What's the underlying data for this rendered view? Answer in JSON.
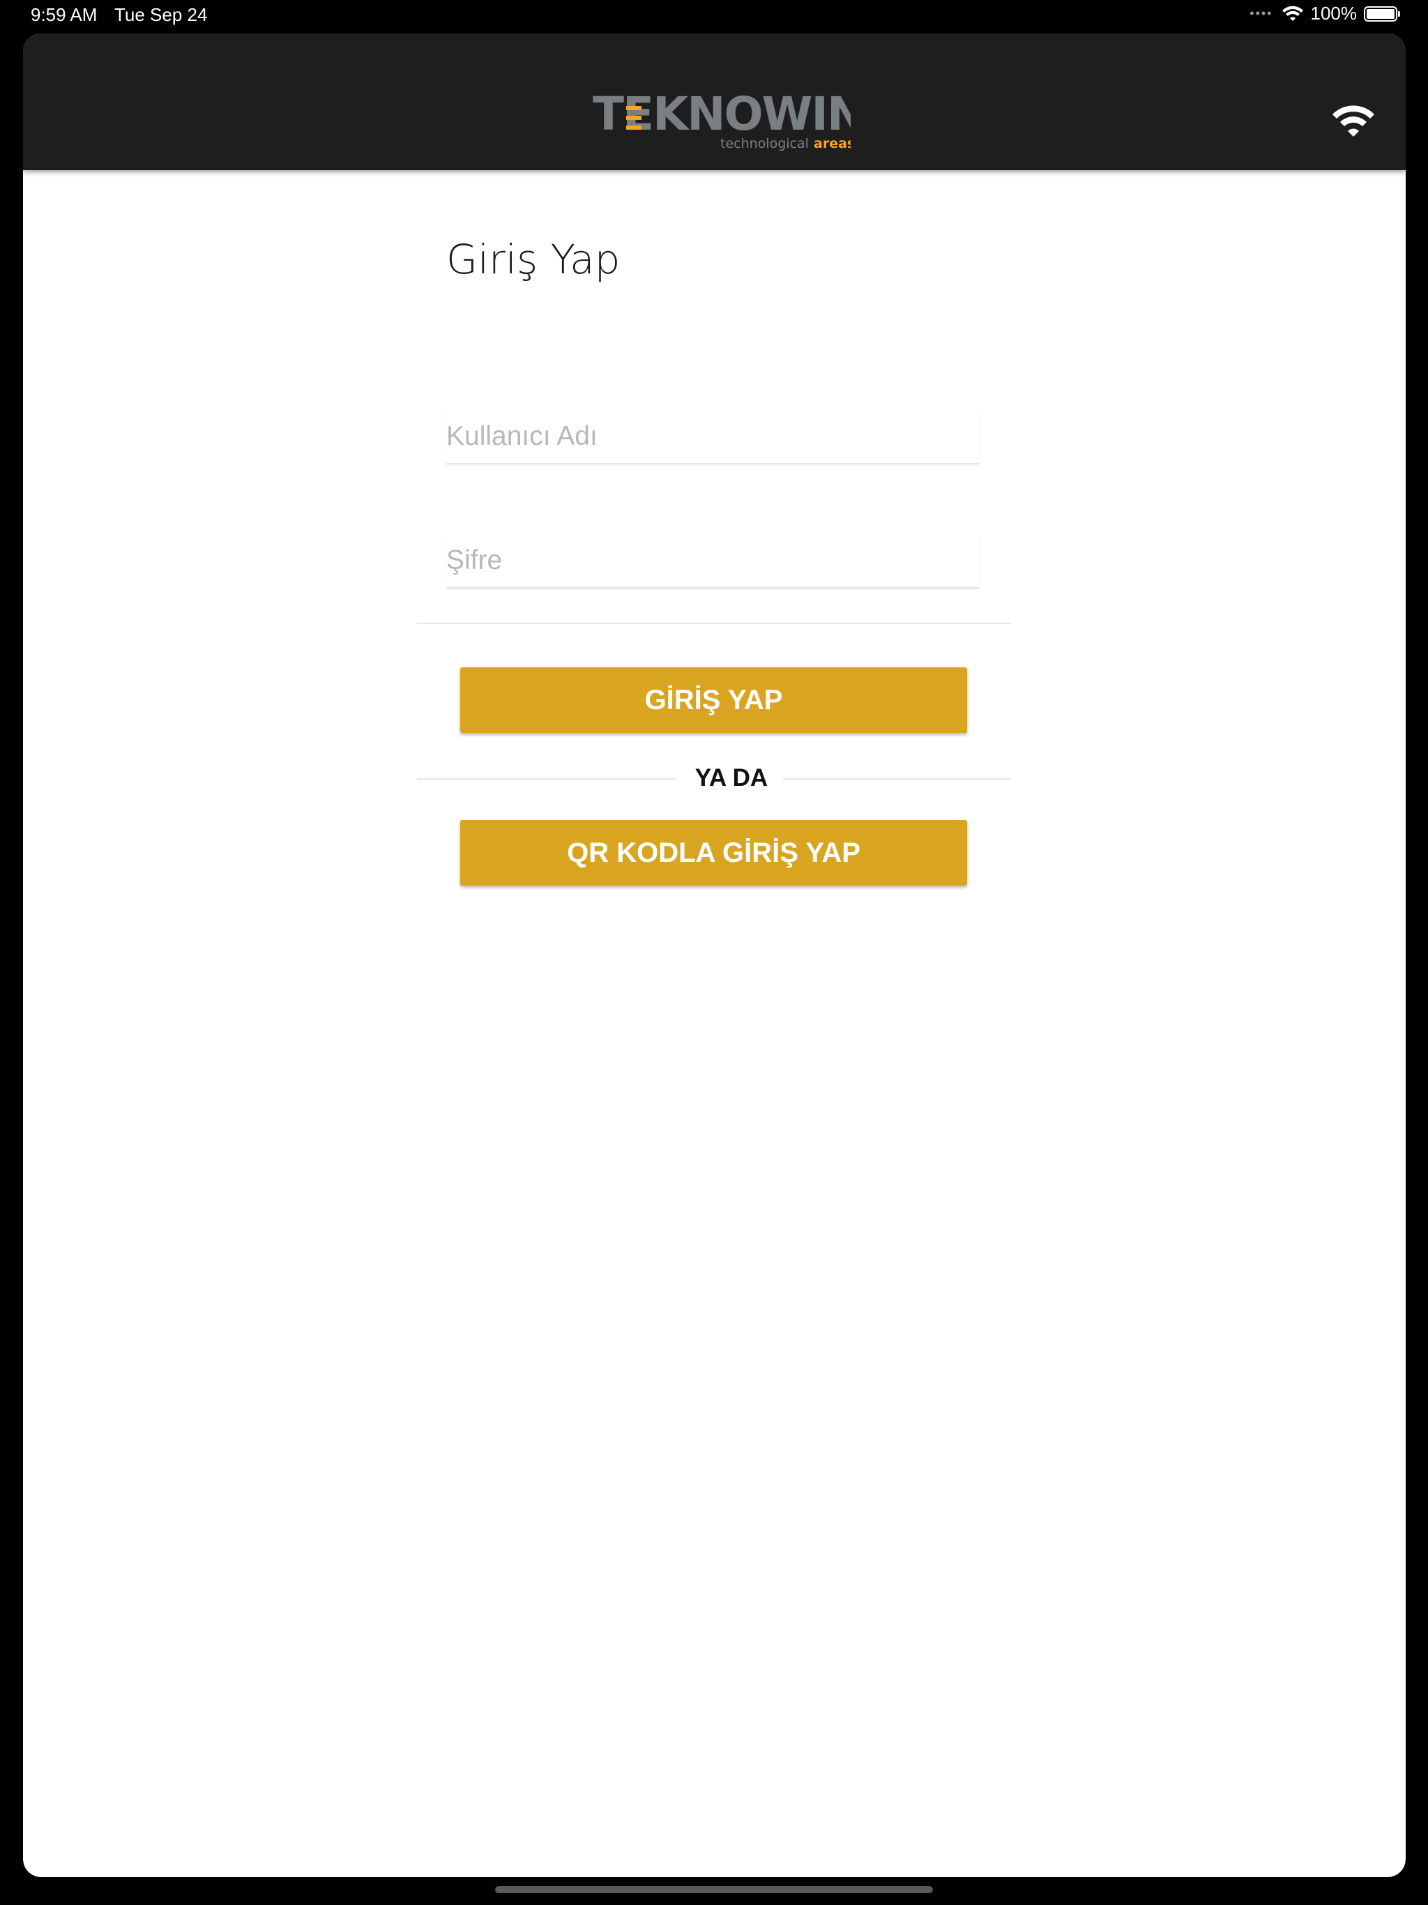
{
  "status_bar": {
    "time": "9:59 AM",
    "date": "Tue Sep 24",
    "battery_percent": "100%",
    "icons": [
      "cellular-dots-icon",
      "wifi-icon",
      "battery-icon"
    ]
  },
  "header": {
    "logo_text": "TEKNOWIN",
    "logo_tagline_part1": "technological",
    "logo_tagline_part2": "areas",
    "connection_icon": "wifi-icon",
    "background_color": "#1e1e1e",
    "logo_gray": "#7a7f83",
    "logo_accent": "#f5a623"
  },
  "login": {
    "title": "Giriş Yap",
    "username_placeholder": "Kullanıcı Adı",
    "username_value": "",
    "password_placeholder": "Şifre",
    "password_value": "",
    "login_button_label": "GİRİŞ YAP",
    "or_label": "YA DA",
    "qr_button_label": "QR KODLA GİRİŞ YAP",
    "button_color": "#d9a520"
  }
}
